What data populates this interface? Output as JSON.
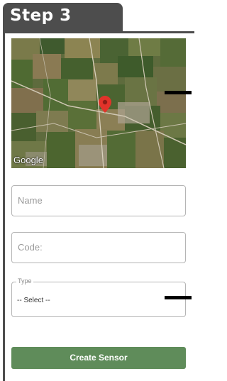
{
  "step": {
    "title": "Step 3"
  },
  "map": {
    "logo": "Google",
    "pin_icon": "map-pin-icon"
  },
  "form": {
    "name": {
      "placeholder": "Name"
    },
    "code": {
      "placeholder": "Code:"
    },
    "type": {
      "label": "Type",
      "selected": "-- Select --"
    },
    "submit_label": "Create Sensor"
  },
  "colors": {
    "tab": "#4d4d4d",
    "button": "#5f8c5a",
    "pin": "#e2332a"
  }
}
